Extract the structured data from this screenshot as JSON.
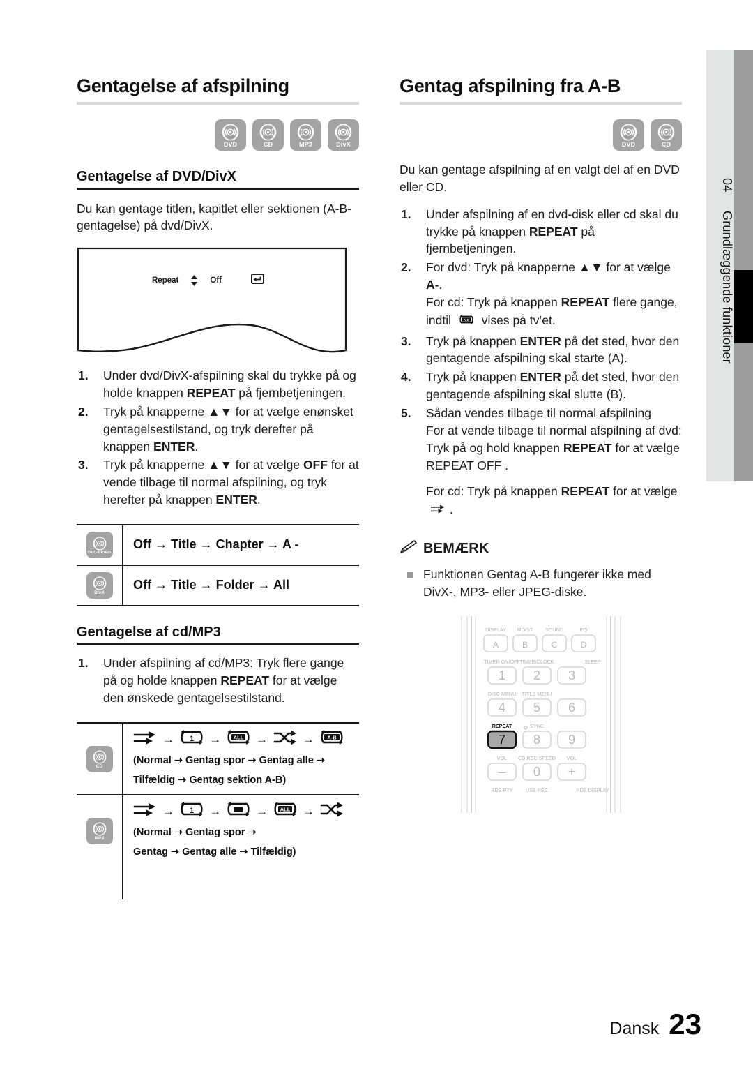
{
  "page": {
    "language_label": "Dansk",
    "page_number": "23",
    "side_tab_number": "04",
    "side_tab_label": "Grundlæggende funktioner"
  },
  "left_column": {
    "title": "Gentagelse af afspilning",
    "disc_badges": [
      {
        "name": "dvd-badge",
        "caption": "DVD"
      },
      {
        "name": "cd-badge",
        "caption": "CD"
      },
      {
        "name": "mp3-badge",
        "caption": "MP3"
      },
      {
        "name": "divx-badge",
        "caption": "DivX"
      }
    ],
    "section_dvd": {
      "heading": "Gentagelse af DVD/DivX",
      "intro": "Du kan gentage titlen, kapitlet eller sektionen (A-B-gentagelse) på dvd/DivX.",
      "osd": {
        "label": "Repeat",
        "updown_icon": "up-down-arrow-icon",
        "value": "Off",
        "return_icon": "return-icon"
      },
      "steps": [
        {
          "num": "1.",
          "parts": [
            {
              "t": "Under dvd/DivX-afspilning skal du trykke på og holde knappen ",
              "b": false
            },
            {
              "t": "REPEAT",
              "b": true
            },
            {
              "t": " på fjernbetjeningen.",
              "b": false
            }
          ]
        },
        {
          "num": "2.",
          "parts": [
            {
              "t": "Tryk på knapperne ",
              "b": false
            },
            {
              "t": "▲▼",
              "b": false
            },
            {
              "t": " for at vælge enønsket gentagelsestilstand, og tryk derefter på knappen ",
              "b": false
            },
            {
              "t": "ENTER",
              "b": true
            },
            {
              "t": ".",
              "b": false
            }
          ]
        },
        {
          "num": "3.",
          "parts": [
            {
              "t": "Tryk på knapperne ",
              "b": false
            },
            {
              "t": "▲▼",
              "b": false
            },
            {
              "t": " for at vælge ",
              "b": false
            },
            {
              "t": "OFF",
              "b": true
            },
            {
              "t": " for at vende tilbage til normal afspilning, og tryk herefter på knappen ",
              "b": false
            },
            {
              "t": "ENTER",
              "b": true
            },
            {
              "t": ".",
              "b": false
            }
          ]
        }
      ],
      "table": [
        {
          "icon_caption": "DVD-VIDEO",
          "icon_name": "dvd-video-badge",
          "sequence": "Off → Title → Chapter → A -"
        },
        {
          "icon_caption": "DivX",
          "icon_name": "divx-badge",
          "sequence": "Off → Title → Folder → All"
        }
      ]
    },
    "section_cd": {
      "heading": "Gentagelse af cd/MP3",
      "steps": [
        {
          "num": "1.",
          "parts": [
            {
              "t": "Under afspilning af cd/MP3: Tryk flere gange på og holde knappen ",
              "b": false
            },
            {
              "t": "REPEAT",
              "b": true
            },
            {
              "t": " for at vælge den ønskede gentagelsestilstand.",
              "b": false
            }
          ]
        }
      ],
      "table": [
        {
          "icon_caption": "CD",
          "icon_name": "cd-badge",
          "symbols": [
            "normal-icon",
            "repeat-one-icon",
            "repeat-all-icon",
            "shuffle-icon",
            "repeat-ab-icon"
          ],
          "caption_lines": [
            "(Normal ➝ Gentag spor  ➝ Gentag alle  ➝",
            "Tilfældig ➝ Gentag sektion A-B)"
          ]
        },
        {
          "icon_caption": "MP3",
          "icon_name": "mp3-badge",
          "symbols": [
            "normal-icon",
            "repeat-one-icon",
            "repeat-folder-icon",
            "repeat-all-icon",
            "shuffle-icon"
          ],
          "caption_lines": [
            "(Normal  ➝ Gentag spor ➝",
            "Gentag  ➝ Gentag alle ➝ Tilfældig)"
          ]
        }
      ]
    }
  },
  "right_column": {
    "title": "Gentag afspilning fra A-B",
    "disc_badges": [
      {
        "name": "dvd-badge",
        "caption": "DVD"
      },
      {
        "name": "cd-badge",
        "caption": "CD"
      }
    ],
    "intro": "Du kan gentage afspilning af en valgt del af en DVD eller CD.",
    "steps": [
      {
        "num": "1.",
        "parts": [
          {
            "t": "Under afspilning af en dvd-disk eller cd skal du trykke på knappen ",
            "b": false
          },
          {
            "t": "REPEAT",
            "b": true
          },
          {
            "t": " på fjernbetjeningen.",
            "b": false
          }
        ]
      },
      {
        "num": "2.",
        "parts": [
          {
            "t": "For dvd: Tryk på knapperne ",
            "b": false
          },
          {
            "t": "▲▼",
            "b": false
          },
          {
            "t": " for at vælge  ",
            "b": false
          },
          {
            "t": "A-",
            "b": true
          },
          {
            "t": ".",
            "b": false
          }
        ],
        "extra_lines": [
          [
            {
              "t": "For cd: Tryk på knappen ",
              "b": false
            },
            {
              "t": "REPEAT",
              "b": true
            },
            {
              "t": " flere gange,",
              "b": false
            }
          ],
          [
            {
              "t": "indtil ",
              "b": false
            },
            {
              "t": "[A-B]",
              "b": false,
              "icon": "repeat-ab-icon"
            },
            {
              "t": " vises på tv’et.",
              "b": false
            }
          ]
        ]
      },
      {
        "num": "3.",
        "parts": [
          {
            "t": "Tryk på knappen ",
            "b": false
          },
          {
            "t": "ENTER",
            "b": true
          },
          {
            "t": " på det sted, hvor den gentagende afspilning skal starte (A).",
            "b": false
          }
        ]
      },
      {
        "num": "4.",
        "parts": [
          {
            "t": "Tryk på knappen ",
            "b": false
          },
          {
            "t": "ENTER",
            "b": true
          },
          {
            "t": " på det sted, hvor den gentagende afspilning skal slutte (B).",
            "b": false
          }
        ]
      },
      {
        "num": "5.",
        "parts": [
          {
            "t": "Sådan vendes tilbage til normal afspilning",
            "b": false
          }
        ],
        "extra_lines": [
          [
            {
              "t": "For at vende tilbage til normal afspilning af dvd:",
              "b": false
            }
          ],
          [
            {
              "t": "Tryk på og hold knappen ",
              "b": false
            },
            {
              "t": "REPEAT",
              "b": true
            },
            {
              "t": " for at vælge",
              "b": false
            }
          ],
          [
            {
              "t": "REPEAT OFF .",
              "b": false
            }
          ]
        ],
        "spaced_line": [
          {
            "t": "For cd: Tryk på knappen ",
            "b": false
          },
          {
            "t": "REPEAT",
            "b": true
          },
          {
            "t": " for at vælge ",
            "b": false
          },
          {
            "t": "[normal]",
            "b": false,
            "icon": "normal-icon"
          },
          {
            "t": ".",
            "b": false
          }
        ]
      }
    ],
    "note": {
      "pencil_icon": "pencil-icon",
      "title": "BEMÆRK",
      "items": [
        "Funktionen Gentag A-B fungerer ikke med DivX-, MP3- eller JPEG-diske."
      ]
    },
    "remote": {
      "name": "remote-control-illustration",
      "highlighted_button": "7",
      "highlighted_label": "REPEAT",
      "rows": [
        {
          "labels": [
            "DISPLAY",
            "MO/ST",
            "SOUND",
            "EQ"
          ],
          "keys": [
            "A",
            "B",
            "C",
            "D"
          ]
        },
        {
          "labels": [
            "TIMER ON/OFF",
            "TIMER/CLOCK",
            "",
            "SLEEP"
          ],
          "keys": [
            "1",
            "2",
            "3"
          ]
        },
        {
          "labels": [
            "DISC MENU",
            "TITLE MENU",
            ""
          ],
          "keys": [
            "4",
            "5",
            "6"
          ]
        },
        {
          "labels": [
            "REPEAT",
            "SYNC",
            ""
          ],
          "keys": [
            "7",
            "8",
            "9"
          ]
        },
        {
          "labels": [
            "VOL",
            "CD REC SPEED",
            "VOL"
          ],
          "keys": [
            "–",
            "0",
            "+"
          ]
        },
        {
          "labels": [
            "RDS PTY",
            "USB REC",
            "",
            "RDS DISPLAY"
          ],
          "keys": []
        }
      ]
    }
  },
  "colors": {
    "badge_gray": "#a3a3a3",
    "rule_gray": "#d5d6d6",
    "tab_light": "#e2e3e3",
    "tab_gray": "#9d9d9d",
    "tab_black": "#000000",
    "bullet_gray": "#9a9a9a"
  }
}
